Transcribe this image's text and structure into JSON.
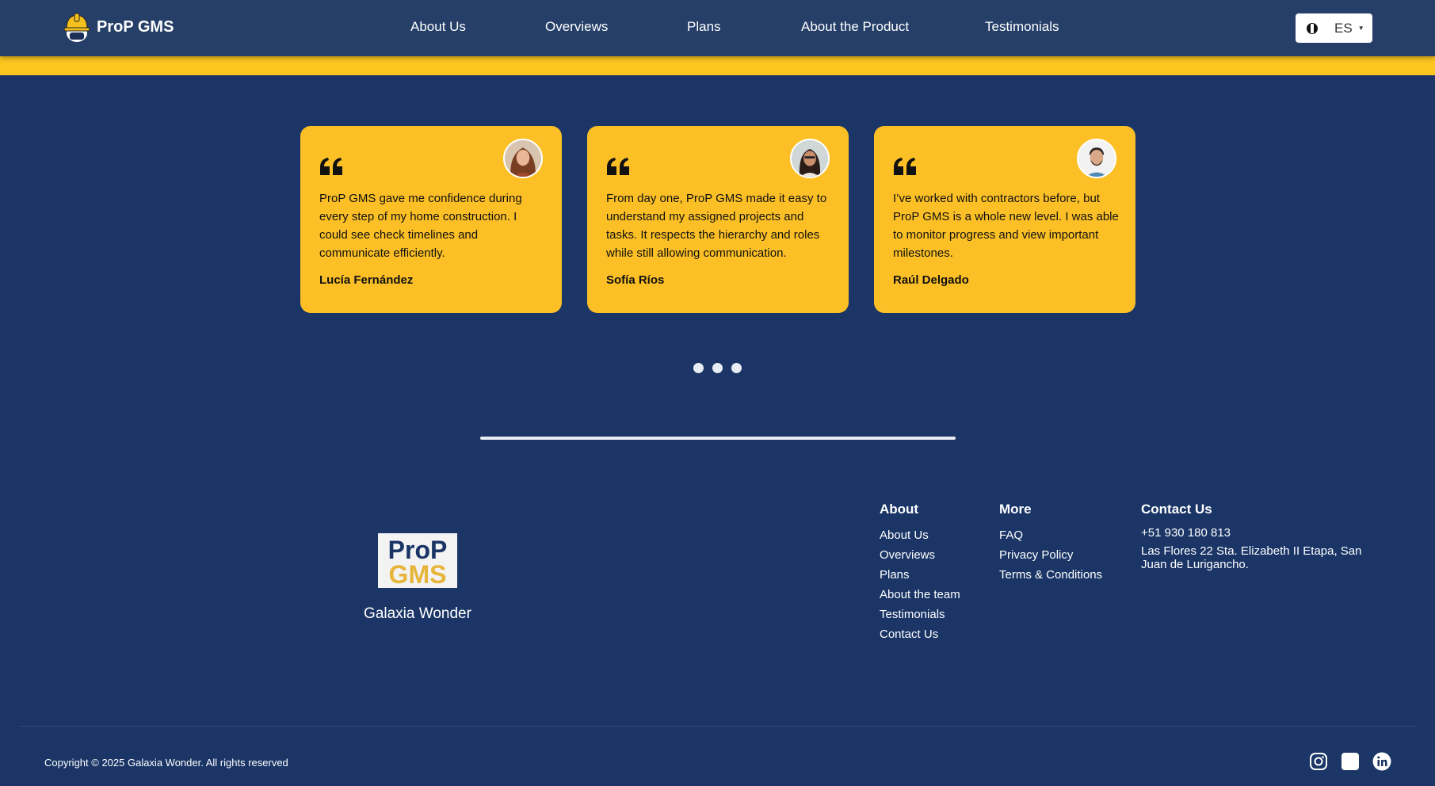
{
  "header": {
    "brand_name": "ProP GMS",
    "nav": [
      "About Us",
      "Overviews",
      "Plans",
      "About the Product",
      "Testimonials"
    ],
    "language": {
      "code": "ES"
    }
  },
  "testimonials": [
    {
      "text": "ProP GMS gave me confidence during every step of my home construction. I could see check timelines and communicate efficiently.",
      "author": "Lucía Fernández"
    },
    {
      "text": "From day one, ProP GMS made it easy to understand my assigned projects and tasks. It respects the hierarchy and roles while still allowing communication.",
      "author": "Sofía Ríos"
    },
    {
      "text": "I’ve worked with contractors before, but ProP GMS is a whole new level. I was able to monitor progress and view important milestones.",
      "author": "Raúl Delgado"
    }
  ],
  "carousel": {
    "pages": 3
  },
  "footer": {
    "logo": {
      "line1": "ProP",
      "line2": "GMS"
    },
    "company": "Galaxia Wonder",
    "about": {
      "title": "About",
      "links": [
        "About Us",
        "Overviews",
        "Plans",
        "About the team",
        "Testimonials",
        "Contact Us"
      ]
    },
    "more": {
      "title": "More",
      "links": [
        "FAQ",
        "Privacy Policy",
        "Terms & Conditions"
      ]
    },
    "contact": {
      "title": "Contact Us",
      "phone": "+51 930 180 813",
      "address": "Las Flores 22 Sta. Elizabeth II Etapa, San Juan de Lurigancho."
    },
    "copyright": "Copyright © 2025 Galaxia Wonder. All rights reserved",
    "socials": [
      "instagram-icon",
      "facebook-icon",
      "linkedin-icon"
    ]
  },
  "colors": {
    "background": "#1a3566",
    "navbar": "#253f69",
    "accent_yellow": "#fcc51f",
    "card": "#fcc026"
  }
}
